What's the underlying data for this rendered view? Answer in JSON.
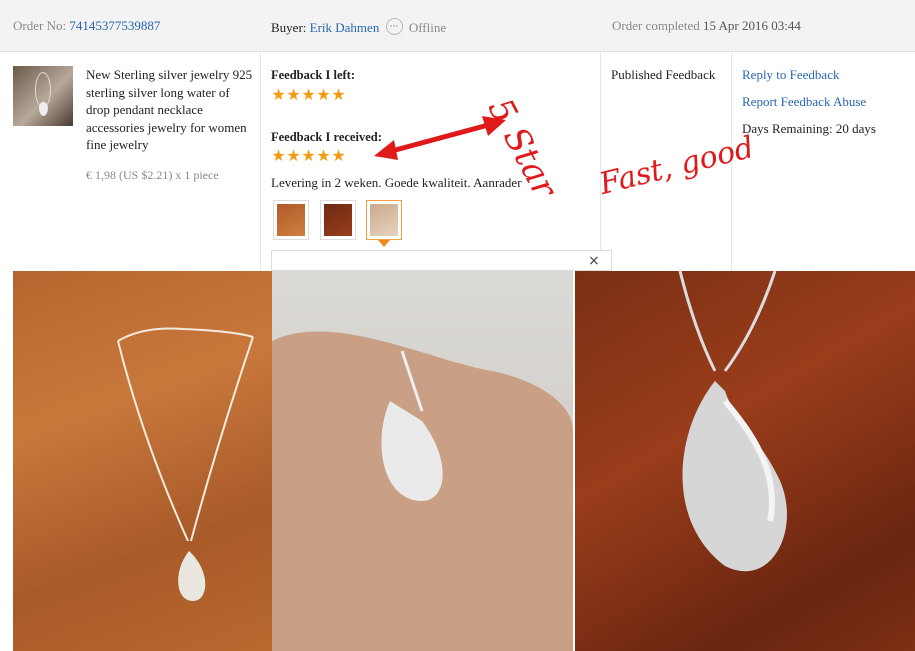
{
  "header": {
    "order_label": "Order No:",
    "order_number": "74145377539887",
    "buyer_label": "Buyer:",
    "buyer_name": "Erik Dahmen",
    "buyer_status": "Offline",
    "completed_label": "Order completed",
    "completed_date": "15 Apr 2016 03:44"
  },
  "product": {
    "title": "New Sterling silver jewelry 925 sterling silver long water of drop pendant necklace accessories jewelry for women fine jewelry",
    "price": "€ 1,98 (US $2.21) x 1 piece"
  },
  "feedback": {
    "left_label": "Feedback I left:",
    "left_stars": 5,
    "received_label": "Feedback I received:",
    "received_stars": 5,
    "review_text": "Levering in 2 weken. Goede kwaliteit. Aanrader",
    "photo_count": 3,
    "selected_photo": 3,
    "close_symbol": "×"
  },
  "status": {
    "published": "Published Feedback"
  },
  "actions": {
    "reply": "Reply to Feedback",
    "report": "Report Feedback Abuse",
    "days_remaining": "Days Remaining: 20 days"
  },
  "annotations": {
    "stars_note": "5 Star",
    "quality_note": "Fast, good"
  },
  "colors": {
    "link": "#2a66b3",
    "star": "#f39c12",
    "annotation": "#e0191b"
  }
}
